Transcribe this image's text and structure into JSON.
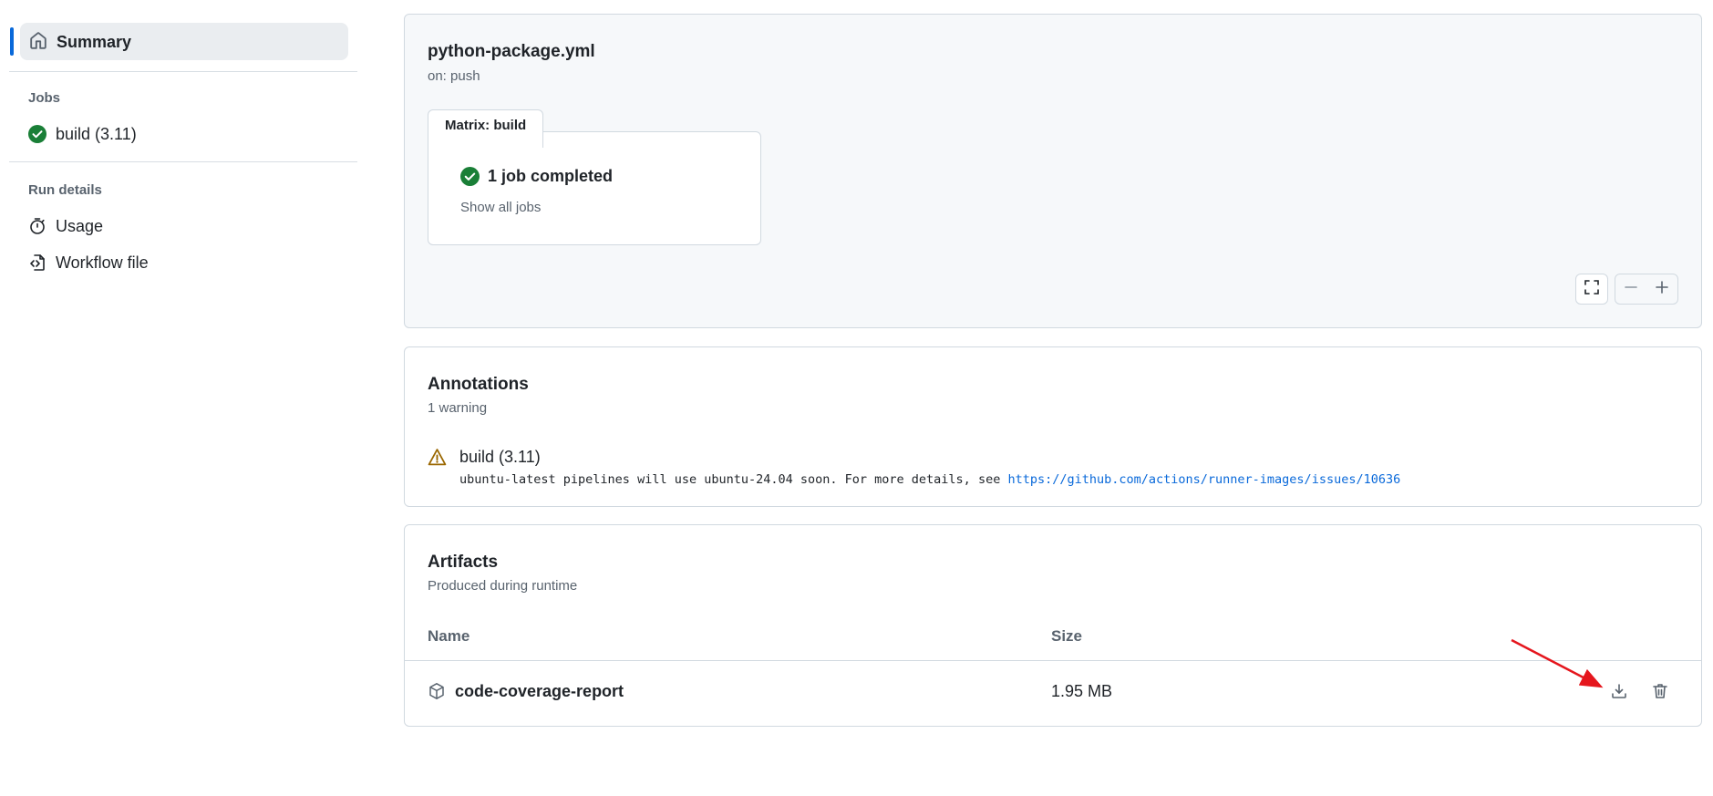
{
  "sidebar": {
    "summary_label": "Summary",
    "jobs_heading": "Jobs",
    "jobs": [
      {
        "label": "build (3.11)",
        "status": "success"
      }
    ],
    "run_details_heading": "Run details",
    "run_details": [
      {
        "label": "Usage",
        "icon": "stopwatch-icon"
      },
      {
        "label": "Workflow file",
        "icon": "file-code-icon"
      }
    ]
  },
  "graph": {
    "workflow_file": "python-package.yml",
    "trigger": "on: push",
    "matrix_label": "Matrix: build",
    "matrix_status": "1 job completed",
    "show_all_label": "Show all jobs"
  },
  "annotations": {
    "title": "Annotations",
    "summary": "1 warning",
    "items": [
      {
        "title": "build (3.11)",
        "message": "ubuntu-latest pipelines will use ubuntu-24.04 soon. For more details, see ",
        "link": "https://github.com/actions/runner-images/issues/10636"
      }
    ]
  },
  "artifacts": {
    "title": "Artifacts",
    "subtitle": "Produced during runtime",
    "columns": {
      "name": "Name",
      "size": "Size"
    },
    "rows": [
      {
        "name": "code-coverage-report",
        "size": "1.95 MB"
      }
    ]
  },
  "colors": {
    "success": "#1a7f37",
    "warning": "#9a6700",
    "link": "#0969da",
    "accent": "#0969da",
    "annotation_arrow": "#e5161d"
  }
}
